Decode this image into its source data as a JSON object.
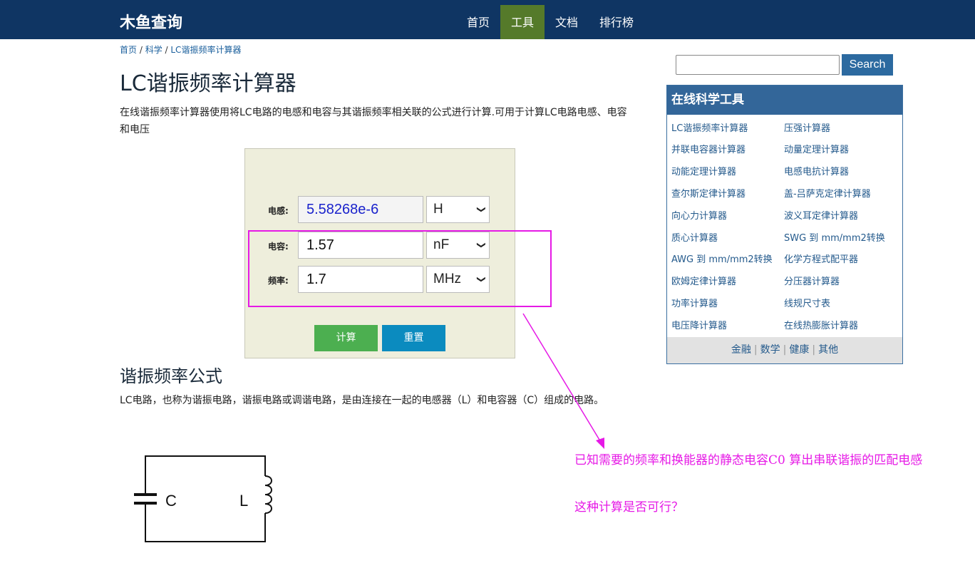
{
  "brand": "木鱼查询",
  "nav": [
    "首页",
    "工具",
    "文档",
    "排行榜"
  ],
  "nav_active_index": 1,
  "breadcrumb": {
    "home": "首页",
    "sep1": " / ",
    "cat": "科学",
    "sep2": " / ",
    "current": "LC谐振频率计算器"
  },
  "title": "LC谐振频率计算器",
  "intro": "在线谐振频率计算器使用将LC电路的电感和电容与其谐振频率相关联的公式进行计算.可用于计算LC电路电感、电容和电压",
  "calculator": {
    "inductance": {
      "label": "电感:",
      "value": "5.58268e-6",
      "unit": "H"
    },
    "capacitance": {
      "label": "电容:",
      "value": "1.57",
      "unit": "nF"
    },
    "frequency": {
      "label": "频率:",
      "value": "1.7",
      "unit": "MHz"
    },
    "calc_button": "计算",
    "reset_button": "重置"
  },
  "section_title": "谐振频率公式",
  "section_text": "LC电路，也称为谐振电路，谐振电路或调谐电路，是由连接在一起的电感器（L）和电容器（C）组成的电路。",
  "circuit": {
    "c_label": "C",
    "l_label": "L"
  },
  "search": {
    "button": "Search",
    "placeholder": ""
  },
  "tools": {
    "title": "在线科学工具",
    "left": [
      "LC谐振频率计算器",
      "并联电容器计算器",
      "动能定理计算器",
      "查尔斯定律计算器",
      "向心力计算器",
      "质心计算器",
      "AWG 到 mm/mm2转换",
      "欧姆定律计算器",
      "功率计算器",
      "电压降计算器"
    ],
    "right": [
      "压强计算器",
      "动量定理计算器",
      "电感电抗计算器",
      "盖-吕萨克定律计算器",
      "波义耳定律计算器",
      "SWG 到 mm/mm2转换",
      "化学方程式配平器",
      "分压器计算器",
      "线规尺寸表",
      "在线热膨胀计算器"
    ],
    "footer": [
      "金融",
      "数学",
      "健康",
      "其他"
    ]
  },
  "annotation": {
    "text": "已知需要的频率和换能器的静态电容C0 算出串联谐振的匹配电感",
    "question": "这种计算是否可行？"
  },
  "colors": {
    "nav_bg": "#0f3563",
    "nav_active": "#557a2a",
    "annotation": "#e619e6",
    "calc_button": "#4caf50",
    "reset_button": "#0b8bbf"
  }
}
